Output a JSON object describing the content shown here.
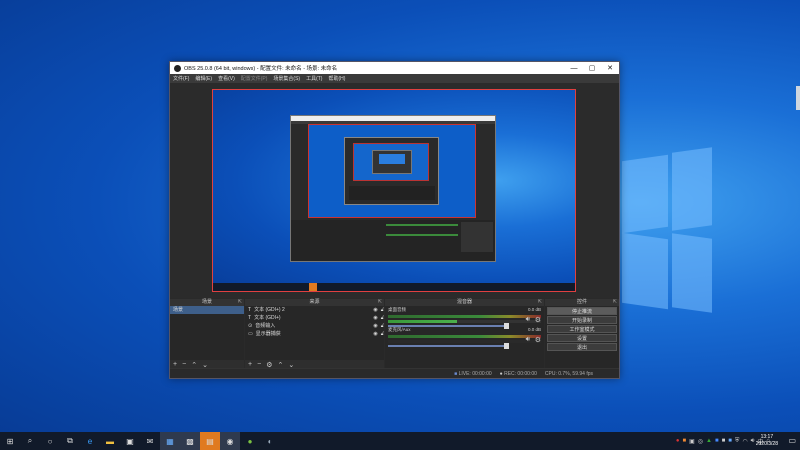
{
  "window": {
    "title": "OBS 25.0.8 (64 bit, windows) - 配置文件: 未命名 - 场景: 未命名",
    "controls": [
      "—",
      "▢",
      "✕"
    ]
  },
  "menubar": [
    "文件(F)",
    "编辑(E)",
    "查看(V)",
    "配置文件(P)",
    "场景集合(S)",
    "工具(T)",
    "帮助(H)"
  ],
  "docks": {
    "scenes": {
      "title": "场景",
      "items": [
        "场景"
      ]
    },
    "sources": {
      "title": "来源",
      "items": [
        {
          "icon": "T",
          "label": "文本 (GDI+) 2"
        },
        {
          "icon": "T",
          "label": "文本 (GDI+)"
        },
        {
          "icon": "⊙",
          "label": "音频输入"
        },
        {
          "icon": "▭",
          "label": "显示器捕获"
        }
      ]
    },
    "mixer": {
      "title": "混音器",
      "channels": [
        {
          "name": "桌面音频",
          "db": "0.0 dB"
        },
        {
          "name": "麦克风/Aux",
          "db": "0.0 dB"
        }
      ]
    },
    "controls": {
      "title": "控件",
      "buttons": [
        "停止推流",
        "开始录制",
        "工作室模式",
        "设置",
        "退出"
      ]
    }
  },
  "statusbar": {
    "live": "LIVE: 00:00:00",
    "rec": "REC: 00:00:00",
    "cpu": "CPU: 0.7%, 59.94 fps"
  },
  "taskbar": {
    "icons": [
      "windows-start",
      "search",
      "cortana",
      "task-view",
      "edge",
      "file-explorer",
      "store",
      "mail",
      "obs-app",
      "obs-app-2",
      "obs-studio",
      "obs-studio-2",
      "wechat",
      "steam"
    ],
    "time": "13:17",
    "date": "2020/3/28",
    "tray_lang": "中"
  }
}
